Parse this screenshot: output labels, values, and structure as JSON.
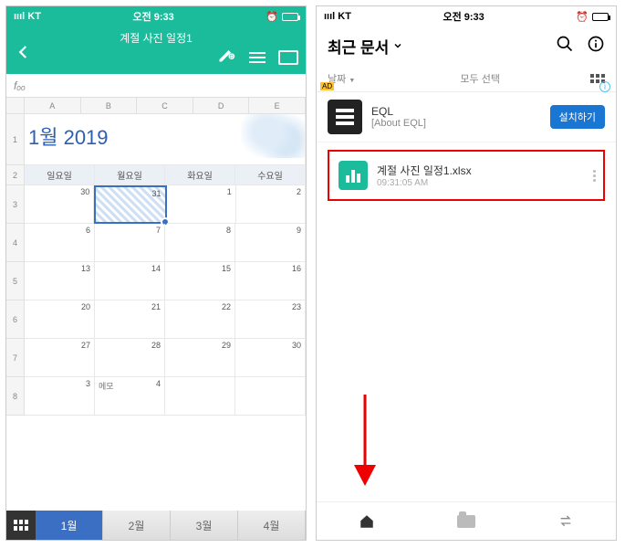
{
  "left": {
    "statusbar": {
      "carrier": "ıııl KT",
      "time": "오전 9:33"
    },
    "header": {
      "title": "계절 사진 일정1"
    },
    "formula_prefix": "fₒₒ",
    "cols": [
      "A",
      "B",
      "C",
      "D",
      "E"
    ],
    "calendar": {
      "title": "1월 2019",
      "day_headers": [
        "일요일",
        "월요일",
        "화요일",
        "수요일"
      ],
      "weeks": [
        [
          {
            "n": "30",
            "prev": true
          },
          {
            "n": "31",
            "prev": true,
            "sel": true
          },
          {
            "n": "1"
          },
          {
            "n": "2"
          }
        ],
        [
          {
            "n": "6"
          },
          {
            "n": "7"
          },
          {
            "n": "8"
          },
          {
            "n": "9"
          }
        ],
        [
          {
            "n": "13"
          },
          {
            "n": "14"
          },
          {
            "n": "15"
          },
          {
            "n": "16"
          }
        ],
        [
          {
            "n": "20"
          },
          {
            "n": "21"
          },
          {
            "n": "22"
          },
          {
            "n": "23"
          }
        ],
        [
          {
            "n": "27"
          },
          {
            "n": "28"
          },
          {
            "n": "29"
          },
          {
            "n": "30"
          }
        ],
        [
          {
            "n": "3"
          },
          {
            "n": "4",
            "memo": "메모"
          },
          {
            "n": ""
          },
          {
            "n": ""
          }
        ]
      ]
    },
    "tabs": [
      "1월",
      "2월",
      "3월",
      "4월"
    ]
  },
  "right": {
    "statusbar": {
      "carrier": "ıııl KT",
      "time": "오전 9:33"
    },
    "title": "최근 문서",
    "subtabs": {
      "date": "날짜",
      "select_all": "모두 선택"
    },
    "ad": {
      "badge": "AD",
      "title": "EQL",
      "sub": "[About EQL]",
      "button": "설치하기"
    },
    "file": {
      "name": "계절 사진 일정1.xlsx",
      "time": "09:31:05 AM"
    }
  }
}
